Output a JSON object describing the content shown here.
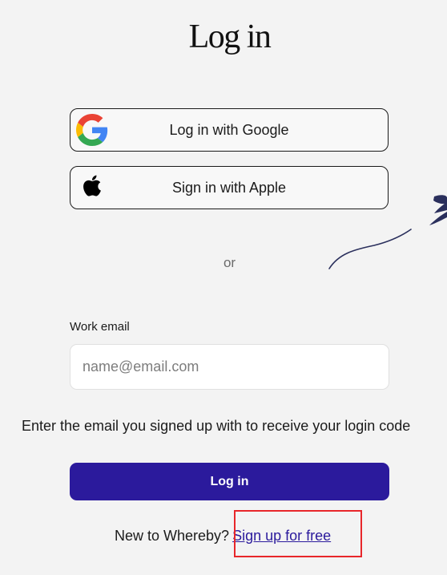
{
  "page": {
    "title": "Log in"
  },
  "sso": {
    "google_label": "Log in with Google",
    "google_icon": "google-g-icon",
    "apple_label": "Sign in with Apple",
    "apple_icon": "apple-logo-icon"
  },
  "divider": {
    "text": "or"
  },
  "email": {
    "label": "Work email",
    "placeholder": "name@email.com",
    "value": ""
  },
  "hint": "Enter the email you signed up with to receive your login code",
  "login_button": {
    "label": "Log in"
  },
  "signup": {
    "prompt": "New to Whereby?",
    "link_label": "Sign up for free"
  },
  "colors": {
    "background": "#f3f3f3",
    "primary": "#2b1a9c",
    "highlight": "#e8262a",
    "decoration": "#2a2f5c"
  }
}
